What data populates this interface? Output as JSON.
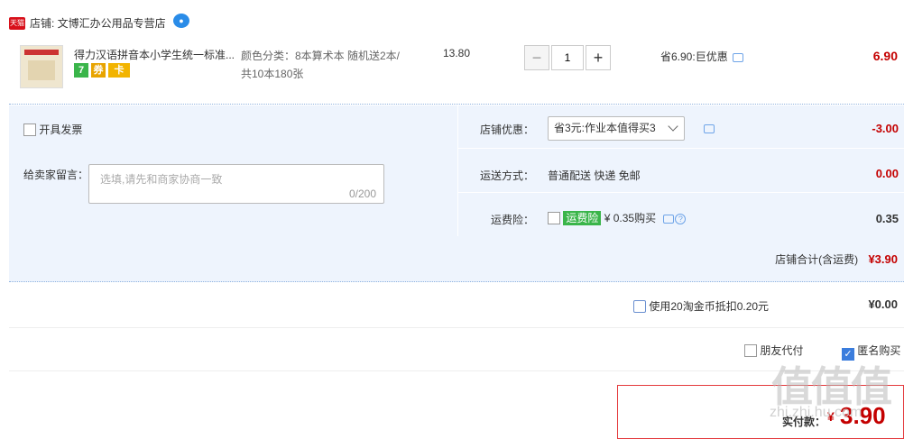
{
  "shop": {
    "badge": "天猫",
    "label": "店铺: 文博汇办公用品专营店",
    "wangwang_icon": "wangwang-chat-icon"
  },
  "item": {
    "title": "得力汉语拼音本小学生统一标准...",
    "service_badges": [
      {
        "text": "7",
        "color": "#3ab54a"
      },
      {
        "text": "券",
        "color": "#e8a400"
      },
      {
        "text": "卡",
        "color": "#f2b400"
      }
    ],
    "sku_line1": "颜色分类：8本算术本 随机送2本/",
    "sku_line2": "共10本180张",
    "unit_price": "13.80",
    "qty_minus": "−",
    "qty_value": "1",
    "qty_plus": "+",
    "promo": "省6.90:巨优惠",
    "total": "6.90"
  },
  "invoice": {
    "label": "开具发票"
  },
  "message": {
    "label": "给卖家留言：",
    "placeholder": "选填,请先和商家协商一致",
    "count": "0/200"
  },
  "discount": {
    "label": "店铺优惠：",
    "selected": "省3元:作业本值得买3",
    "amount": "-3.00"
  },
  "shipping": {
    "label": "运送方式：",
    "method": "普通配送 快递 免邮",
    "amount": "0.00"
  },
  "insurance": {
    "label": "运费险：",
    "tag": "运费险",
    "price": "¥ 0.35购买",
    "amount": "0.35"
  },
  "shop_total": {
    "label": "店铺合计(含运费)",
    "amount": "¥3.90"
  },
  "coins": {
    "label": "使用20淘金币抵扣0.20元",
    "amount": "¥0.00"
  },
  "options": {
    "friend_pay": "朋友代付",
    "anonymous": "匿名购买",
    "anonymous_checked": true
  },
  "payment": {
    "label": "实付款：",
    "currency": "¥",
    "amount": "3.90"
  },
  "watermark": {
    "chars": "值值值",
    "site": "zhi.zhi.hu.com"
  }
}
